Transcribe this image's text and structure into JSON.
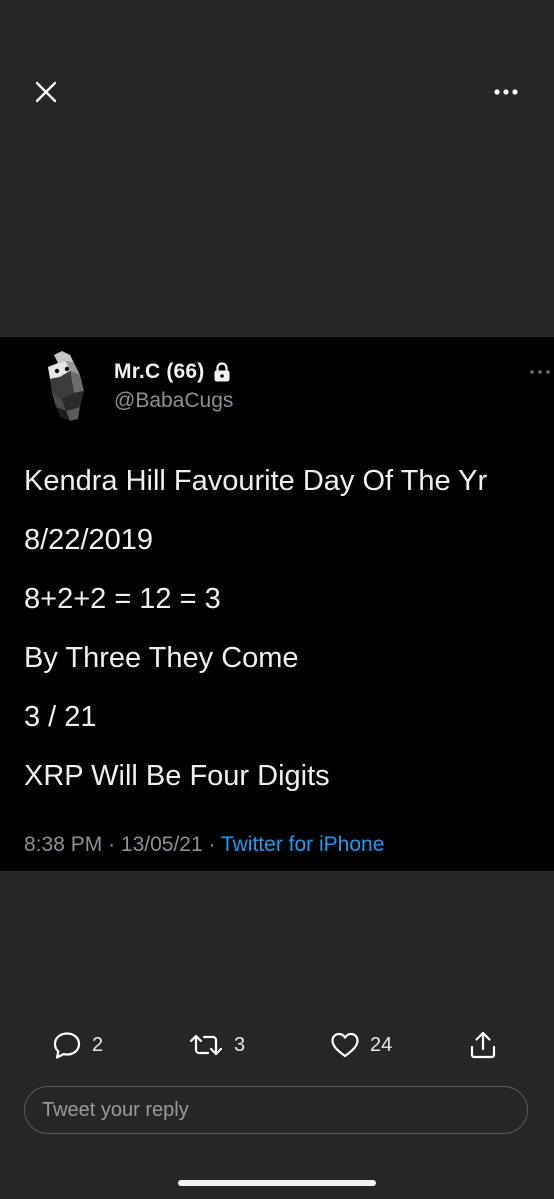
{
  "tweet": {
    "display_name": "Mr.C (66)",
    "handle": "@BabaCugs",
    "lines": [
      "Kendra Hill Favourite Day Of The Yr",
      "8/22/2019",
      "8+2+2 = 12 = 3",
      "By Three They Come",
      "3 / 21",
      "XRP Will Be Four Digits"
    ],
    "time": "8:38 PM",
    "date": "13/05/21",
    "separator": "·",
    "source": "Twitter for iPhone"
  },
  "actions": {
    "reply_count": "2",
    "retweet_count": "3",
    "like_count": "24"
  },
  "reply": {
    "placeholder": "Tweet your reply"
  },
  "icons": {
    "close": "close-icon",
    "more": "more-horizontal-icon",
    "lock": "lock-icon",
    "reply": "reply-bubble-icon",
    "retweet": "retweet-icon",
    "like": "heart-icon",
    "share": "share-upload-icon"
  },
  "colors": {
    "background": "#262626",
    "image_background": "#000000",
    "link": "#1d9bf0",
    "muted": "#8b9096"
  }
}
